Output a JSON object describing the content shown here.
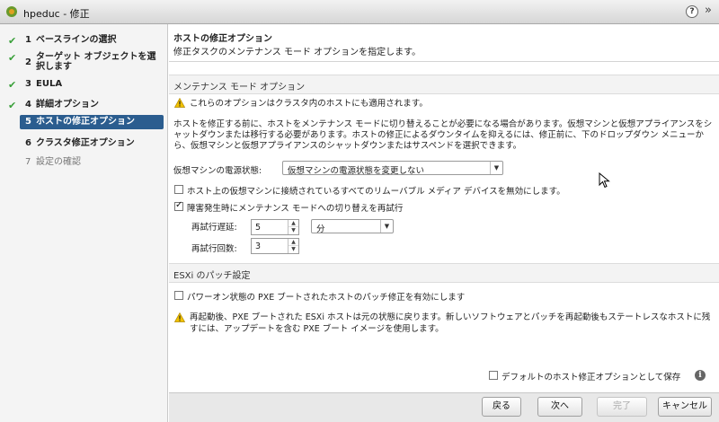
{
  "window": {
    "title": "hpeduc - 修正",
    "help_icon": "question-icon",
    "close_icon": "close-icon"
  },
  "sidebar": {
    "steps": [
      {
        "num": "1",
        "label": "ベースラインの選択",
        "state": "done"
      },
      {
        "num": "2",
        "label": "ターゲット オブジェクトを選択します",
        "state": "done"
      },
      {
        "num": "3",
        "label": "EULA",
        "state": "done"
      },
      {
        "num": "4",
        "label": "詳細オプション",
        "state": "done"
      },
      {
        "num": "5",
        "label": "ホストの修正オプション",
        "state": "active"
      },
      {
        "num": "6",
        "label": "クラスタ修正オプション",
        "state": "pending"
      },
      {
        "num": "7",
        "label": "設定の確認",
        "state": "disabled"
      }
    ]
  },
  "main": {
    "title": "ホストの修正オプション",
    "description": "修正タスクのメンテナンス モード オプションを指定します。",
    "maintenance": {
      "heading": "メンテナンス モード オプション",
      "warning": "これらのオプションはクラスタ内のホストにも適用されます。",
      "paragraph": "ホストを修正する前に、ホストをメンテナンス モードに切り替えることが必要になる場合があります。仮想マシンと仮想アプライアンスをシャットダウンまたは移行する必要があります。ホストの修正によるダウンタイムを抑えるには、修正前に、下のドロップダウン メニューから、仮想マシンと仮想アプライアンスのシャットダウンまたはサスペンドを選択できます。",
      "power_state_label": "仮想マシンの電源状態:",
      "power_state_value": "仮想マシンの電源状態を変更しない",
      "disable_media_label": "ホスト上の仮想マシンに接続されているすべてのリムーバブル メディア デバイスを無効にします。",
      "disable_media_checked": false,
      "retry_label": "障害発生時にメンテナンス モードへの切り替えを再試行",
      "retry_checked": true,
      "retry_delay_label": "再試行遅延:",
      "retry_delay_value": "5",
      "retry_delay_unit": "分",
      "retry_count_label": "再試行回数:",
      "retry_count_value": "3"
    },
    "esxi": {
      "heading": "ESXi のパッチ設定",
      "pxe_label": "パワーオン状態の PXE ブートされたホストのパッチ修正を有効にします",
      "pxe_checked": false,
      "warning": "再起動後、PXE ブートされた ESXi ホストは元の状態に戻ります。新しいソフトウェアとパッチを再起動後もステートレスなホストに残すには、アップデートを含む PXE ブート イメージを使用します。"
    },
    "save_default_label": "デフォルトのホスト修正オプションとして保存",
    "save_default_checked": false
  },
  "footer": {
    "back": "戻る",
    "next": "次へ",
    "finish": "完了",
    "cancel": "キャンセル"
  },
  "colors": {
    "active_step_bg": "#2b5d8f",
    "check_green": "#3aa03a",
    "warning_yellow": "#f2c200"
  }
}
